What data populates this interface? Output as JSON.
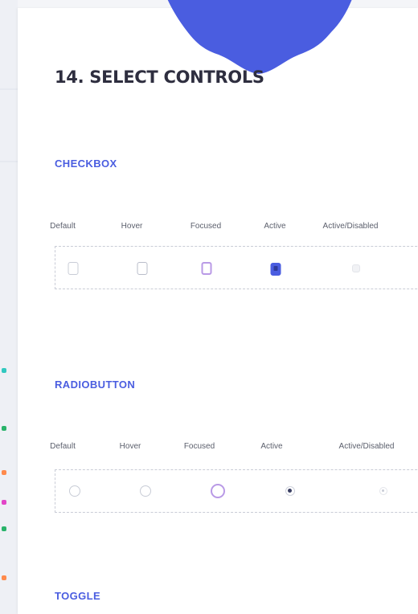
{
  "section": {
    "title": "14. SELECT CONTROLS"
  },
  "checkbox": {
    "label": "CHECKBOX",
    "states": [
      "Default",
      "Hover",
      "Focused",
      "Active",
      "Active/Disabled"
    ]
  },
  "radiobutton": {
    "label": "RADIOBUTTON",
    "states": [
      "Default",
      "Hover",
      "Focused",
      "Active",
      "Active/Disabled"
    ]
  },
  "toggle": {
    "label": "TOGGLE"
  },
  "colors": {
    "accent": "#4a5de0",
    "focus": "#b99ae6",
    "blob": "#4a5de0",
    "title": "#2e2e3f"
  }
}
